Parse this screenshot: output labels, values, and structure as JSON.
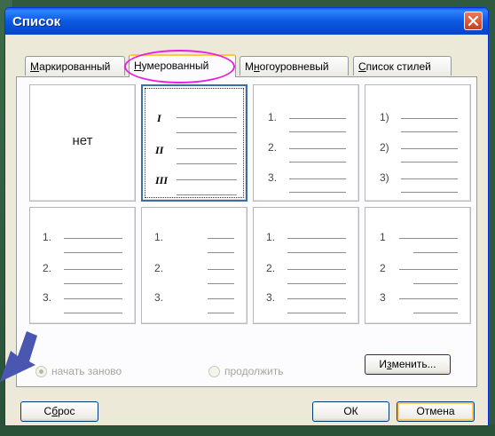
{
  "window": {
    "title": "Список"
  },
  "tabs": [
    {
      "pre": "",
      "ul": "М",
      "post": "аркированный"
    },
    {
      "pre": "",
      "ul": "Н",
      "post": "умерованный"
    },
    {
      "pre": "М",
      "ul": "н",
      "post": "огоуровневый"
    },
    {
      "pre": "",
      "ul": "С",
      "post": "писок стилей"
    }
  ],
  "gallery": {
    "none_label": "нет",
    "roman": [
      "I",
      "II",
      "III"
    ],
    "arabic_dot": [
      "1.",
      "2.",
      "3."
    ],
    "arabic_paren": [
      "1)",
      "2)",
      "3)"
    ],
    "arabic_plain": [
      "1",
      "2",
      "3"
    ]
  },
  "options": {
    "restart_label": "начать заново",
    "continue_label": "продолжить"
  },
  "buttons": {
    "modify_pre": "И",
    "modify_ul": "з",
    "modify_post": "менить...",
    "reset_pre": "С",
    "reset_ul": "б",
    "reset_post": "рос",
    "ok": "ОК",
    "cancel": "Отмена"
  },
  "colors": {
    "highlight": "#e81ee0",
    "arrow": "#4a57b0",
    "titlebar": "#0b59e0"
  }
}
